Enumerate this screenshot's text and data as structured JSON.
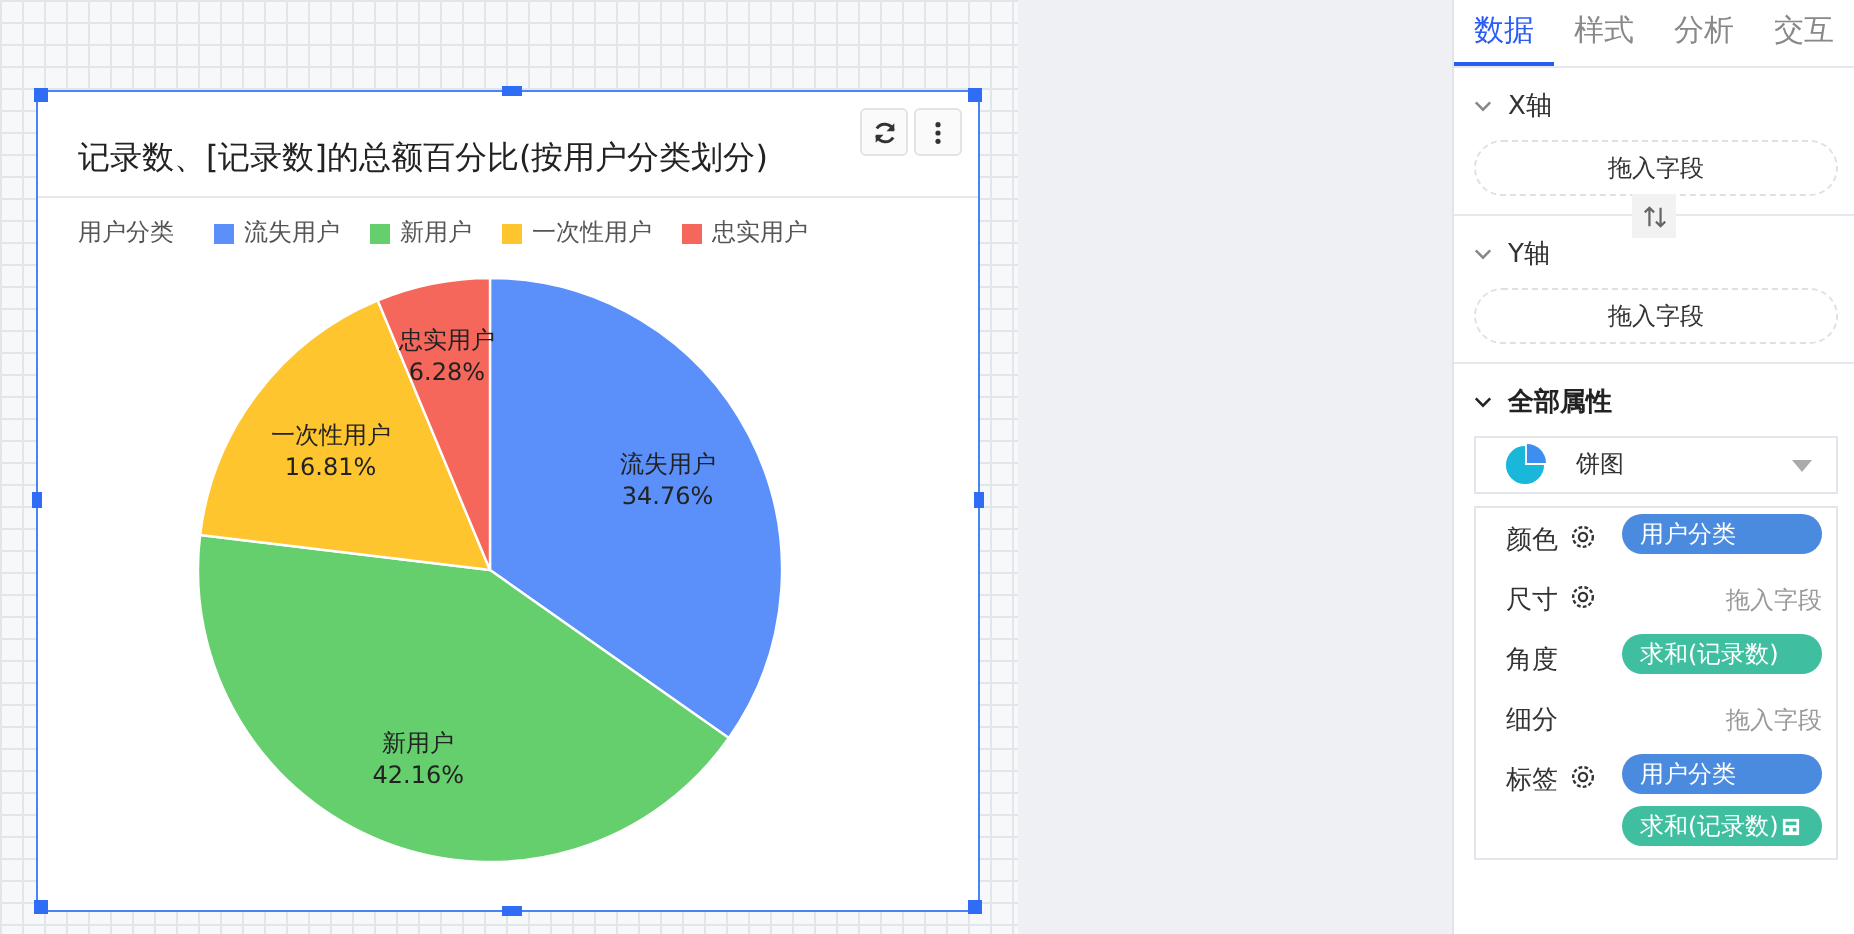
{
  "chart_card": {
    "title": "记录数、[记录数]的总额百分比(按用户分类划分)",
    "legend": {
      "title": "用户分类",
      "items": [
        {
          "label": "流失用户",
          "color": "#5b8ff9"
        },
        {
          "label": "新用户",
          "color": "#66cf6d"
        },
        {
          "label": "一次性用户",
          "color": "#fec52f"
        },
        {
          "label": "忠实用户",
          "color": "#f5675b"
        }
      ]
    },
    "chart_data": {
      "type": "pie",
      "categories": [
        "流失用户",
        "新用户",
        "一次性用户",
        "忠实用户"
      ],
      "values": [
        34.76,
        42.16,
        16.81,
        6.28
      ],
      "value_labels": [
        "34.76%",
        "42.16%",
        "16.81%",
        "6.28%"
      ]
    }
  },
  "panel": {
    "tabs": [
      {
        "label": "数据",
        "selected": true
      },
      {
        "label": "样式",
        "selected": false
      },
      {
        "label": "分析",
        "selected": false
      },
      {
        "label": "交互",
        "selected": false
      }
    ],
    "axes": [
      {
        "title": "X轴",
        "drop": "拖入字段"
      },
      {
        "title": "Y轴",
        "drop": "拖入字段"
      }
    ],
    "properties_title": "全部属性",
    "chart_type": "饼图",
    "properties": [
      {
        "label": "颜色",
        "gear": true,
        "fields": [
          {
            "kind": "dimension",
            "text": "用户分类"
          }
        ]
      },
      {
        "label": "尺寸",
        "gear": true,
        "placeholder": "拖入字段"
      },
      {
        "label": "角度",
        "gear": false,
        "fields": [
          {
            "kind": "measure",
            "text": "求和(记录数)"
          }
        ]
      },
      {
        "label": "细分",
        "gear": false,
        "placeholder": "拖入字段"
      },
      {
        "label": "标签",
        "gear": true,
        "fields": [
          {
            "kind": "dimension",
            "text": "用户分类"
          },
          {
            "kind": "measure",
            "text": "求和(记录数)",
            "calc": true
          }
        ]
      }
    ]
  }
}
